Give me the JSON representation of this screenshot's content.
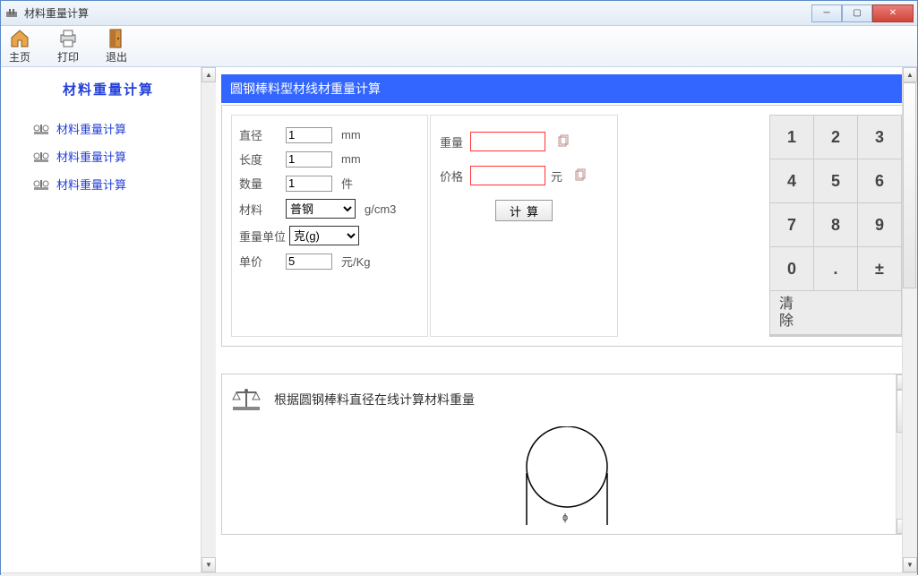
{
  "window": {
    "title": "材料重量计算"
  },
  "toolbar": {
    "home": "主页",
    "print": "打印",
    "exit": "退出"
  },
  "sidebar": {
    "title": "材料重量计算",
    "items": [
      {
        "label": "材料重量计算"
      },
      {
        "label": "材料重量计算"
      },
      {
        "label": "材料重量计算"
      }
    ]
  },
  "panel": {
    "title": "圆钢棒料型材线材重量计算"
  },
  "inputs": {
    "diameter": {
      "label": "直径",
      "value": "1",
      "unit": "mm"
    },
    "length": {
      "label": "长度",
      "value": "1",
      "unit": "mm"
    },
    "quantity": {
      "label": "数量",
      "value": "1",
      "unit": "件"
    },
    "material": {
      "label": "材料",
      "value": "普钢",
      "unit": "g/cm3"
    },
    "weight_unit": {
      "label": "重量单位",
      "value": "克(g)"
    },
    "price": {
      "label": "单价",
      "value": "5",
      "unit": "元/Kg"
    }
  },
  "outputs": {
    "weight": {
      "label": "重量",
      "value": ""
    },
    "cost": {
      "label": "价格",
      "value": "",
      "unit": "元"
    },
    "calc_button": "计算"
  },
  "keypad": {
    "keys": [
      "1",
      "2",
      "3",
      "4",
      "5",
      "6",
      "7",
      "8",
      "9",
      "0",
      ".",
      "±"
    ],
    "clear": "清\n除"
  },
  "bottom": {
    "title": "根据圆钢棒料直径在线计算材料重量"
  }
}
